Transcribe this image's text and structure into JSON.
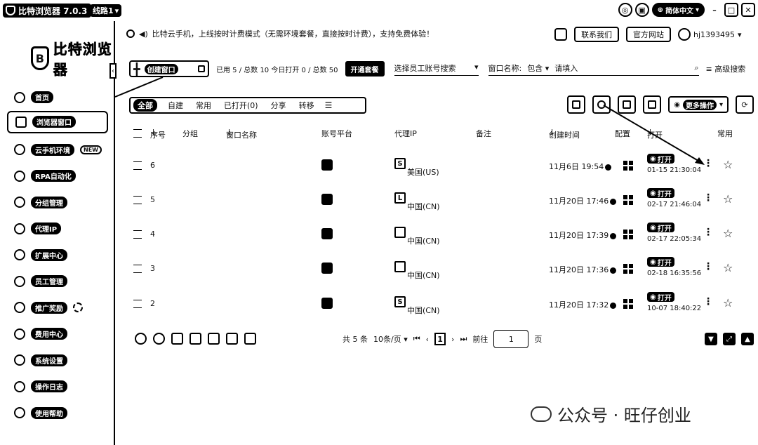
{
  "titlebar": {
    "app_title": "比特浏览器 7.0.3",
    "line_label": "线路1",
    "lang_label": "简体中文"
  },
  "sidebar": {
    "brand": "比特浏览器",
    "items": [
      {
        "label": "首页"
      },
      {
        "label": "浏览器窗口"
      },
      {
        "label": "云手机环境",
        "badge": "NEW"
      },
      {
        "label": "RPA自动化"
      },
      {
        "label": "分组管理"
      },
      {
        "label": "代理IP"
      },
      {
        "label": "扩展中心"
      },
      {
        "label": "员工管理"
      },
      {
        "label": "推广奖励"
      },
      {
        "label": "费用中心"
      },
      {
        "label": "系统设置"
      },
      {
        "label": "操作日志"
      },
      {
        "label": "使用帮助"
      }
    ]
  },
  "header": {
    "notice": "比特云手机，上线按时计费模式（无需环境套餐，直接按时计费），支持免费体验！",
    "contact": "联系我们",
    "website": "官方网站",
    "username": "hj1393495"
  },
  "toolbar": {
    "create_label": "创建窗口",
    "stats": "已用 5 / 总数 10   今日打开 0 / 总数 50",
    "team_btn": "开通套餐",
    "employee_select": "选择员工账号搜索",
    "filter_label": "窗口名称:",
    "filter_mode": "包含",
    "filter_placeholder": "请填入",
    "advanced": "高级搜索",
    "more_ops": "更多操作"
  },
  "tabs": [
    {
      "label": "全部",
      "active": true
    },
    {
      "label": "自建"
    },
    {
      "label": "常用"
    },
    {
      "label": "已打开(0)"
    },
    {
      "label": "分享"
    },
    {
      "label": "转移"
    }
  ],
  "table": {
    "headers": {
      "seq": "序号",
      "group": "分组",
      "name": "窗口名称",
      "platform": "账号平台",
      "proxy": "代理IP",
      "remark": "备注",
      "created": "创建时间",
      "config": "配置",
      "open": "打开",
      "fav": "常用"
    },
    "open_label": "打开",
    "rows": [
      {
        "seq": "6",
        "proxy_icon": "S",
        "proxy_country": "美国(US)",
        "created": "11月6日 19:54",
        "last_open": "01-15 21:30:04"
      },
      {
        "seq": "5",
        "proxy_icon": "L",
        "proxy_country": "中国(CN)",
        "created": "11月20日 17:46",
        "last_open": "02-17 21:46:04"
      },
      {
        "seq": "4",
        "proxy_icon": "",
        "proxy_country": "中国(CN)",
        "created": "11月20日 17:39",
        "last_open": "02-17 22:05:34"
      },
      {
        "seq": "3",
        "proxy_icon": "",
        "proxy_country": "中国(CN)",
        "created": "11月20日 17:36",
        "last_open": "02-18 16:35:56"
      },
      {
        "seq": "2",
        "proxy_icon": "S",
        "proxy_country": "中国(CN)",
        "created": "11月20日 17:32",
        "last_open": "10-07 18:40:22"
      }
    ]
  },
  "pager": {
    "total": "共 5 条",
    "per_page": "10条/页",
    "current": "1",
    "goto_label": "前往",
    "goto_value": "1",
    "page_unit": "页"
  },
  "watermark": "公众号 · 旺仔创业"
}
